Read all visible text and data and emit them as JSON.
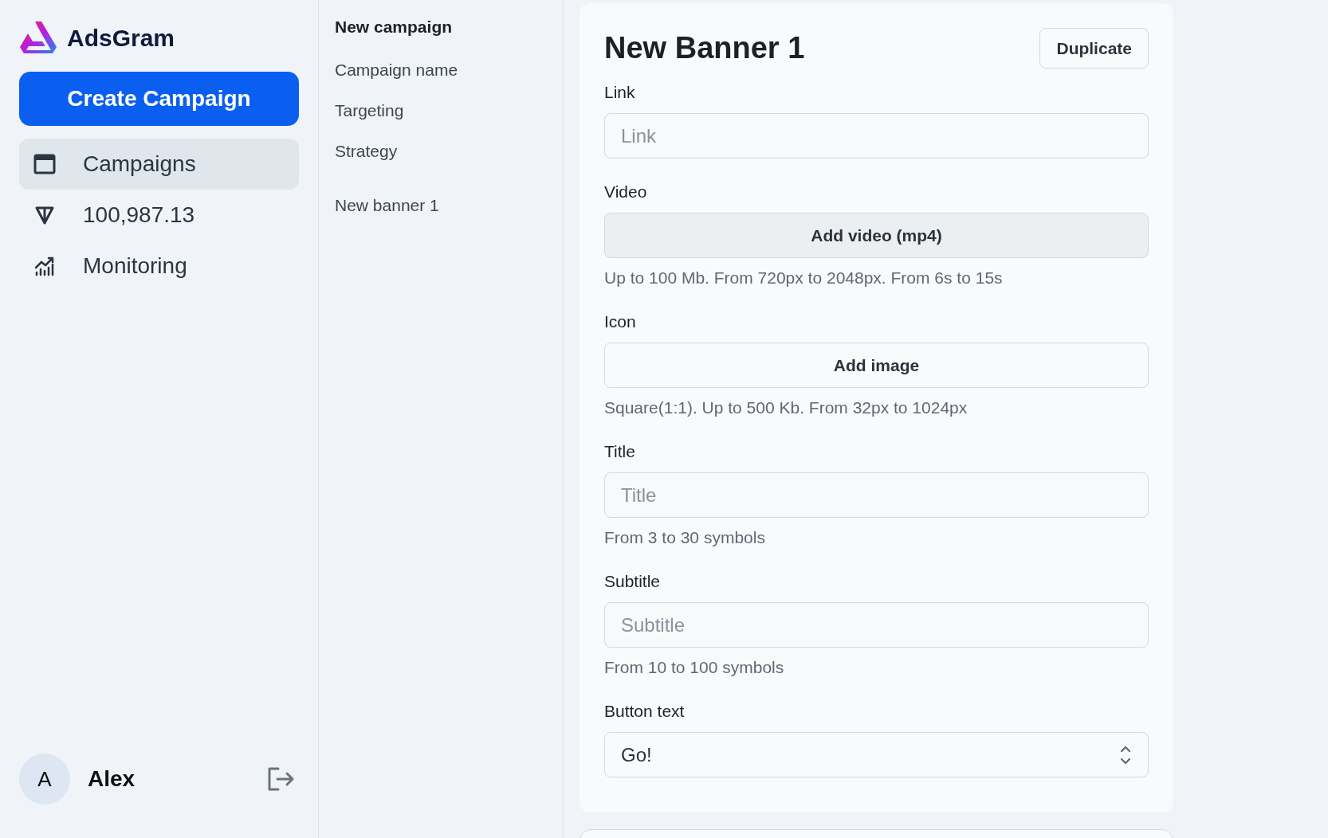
{
  "brand": {
    "name": "AdsGram"
  },
  "sidebar": {
    "create_button": "Create Campaign",
    "items": [
      {
        "label": "Campaigns",
        "selected": true
      },
      {
        "label": "100,987.13",
        "selected": false
      },
      {
        "label": "Monitoring",
        "selected": false
      }
    ]
  },
  "user": {
    "initial": "A",
    "name": "Alex"
  },
  "outline": {
    "heading": "New campaign",
    "items": [
      "Campaign name",
      "Targeting",
      "Strategy"
    ],
    "banners": [
      "New banner 1"
    ]
  },
  "banner": {
    "title": "New Banner 1",
    "duplicate_button": "Duplicate",
    "fields": [
      {
        "kind": "input",
        "label": "Link",
        "placeholder": "Link"
      },
      {
        "kind": "upload",
        "label": "Video",
        "button": "Add video (mp4)",
        "filled": true,
        "hint": "Up to 100 Mb. From 720px to 2048px. From 6s to 15s"
      },
      {
        "kind": "upload",
        "label": "Icon",
        "button": "Add image",
        "filled": false,
        "hint": "Square(1:1). Up to 500 Kb. From 32px to 1024px"
      },
      {
        "kind": "input",
        "label": "Title",
        "placeholder": "Title",
        "hint": "From 3 to 30 symbols"
      },
      {
        "kind": "input",
        "label": "Subtitle",
        "placeholder": "Subtitle",
        "hint": "From 10 to 100 symbols"
      },
      {
        "kind": "select",
        "label": "Button text",
        "value": "Go!"
      }
    ]
  }
}
